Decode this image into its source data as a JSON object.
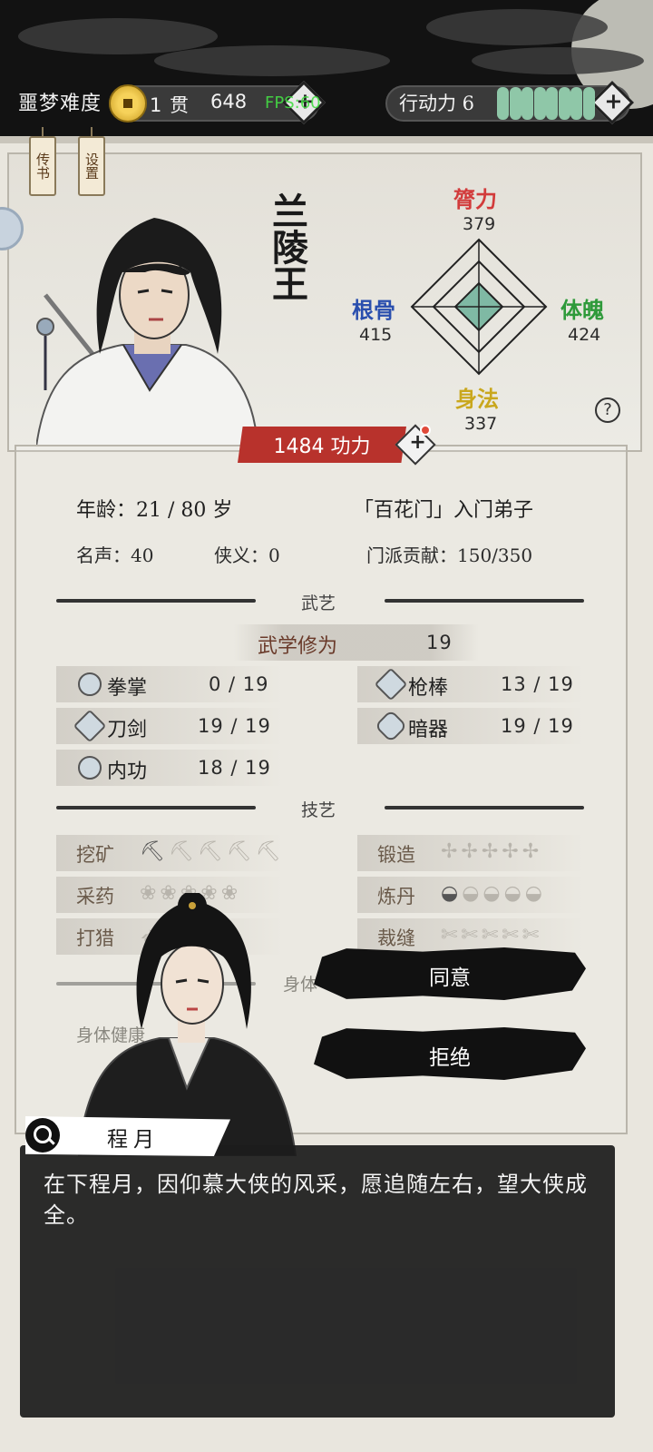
{
  "topbar": {
    "difficulty": "噩梦难度",
    "coins_count": "1 贯",
    "coins_sub": "648",
    "fps_overlay": "FPS:60",
    "action_label": "行动力 6",
    "stamina_filled": 8
  },
  "tassels": {
    "book": "传书",
    "settings": "设置"
  },
  "character": {
    "name": "兰陵王",
    "power": "1484 功力",
    "attributes": {
      "strength": {
        "label": "膂力",
        "value": "379",
        "color": "#d23b3b"
      },
      "constitution": {
        "label": "根骨",
        "value": "415",
        "color": "#2a4fae"
      },
      "physique": {
        "label": "体魄",
        "value": "424",
        "color": "#2e9a3a"
      },
      "agility": {
        "label": "身法",
        "value": "337",
        "color": "#c9a71d"
      }
    }
  },
  "info": {
    "age": "年龄：21 / 80 岁",
    "sect": "「百花门」入门弟子",
    "fame": "名声：40",
    "chivalry": "侠义：0",
    "contribution": "门派贡献：150/350"
  },
  "martial": {
    "section_title": "武艺",
    "cultivation_label": "武学修为",
    "cultivation_value": "19",
    "skills": [
      {
        "label": "拳掌",
        "value": "0 / 19"
      },
      {
        "label": "枪棒",
        "value": "13 / 19"
      },
      {
        "label": "刀剑",
        "value": "19 / 19"
      },
      {
        "label": "暗器",
        "value": "19 / 19"
      },
      {
        "label": "内功",
        "value": "18 / 19"
      }
    ]
  },
  "crafts": {
    "section_title": "技艺",
    "items": [
      {
        "label": "挖矿",
        "level": 1
      },
      {
        "label": "锻造",
        "level": 0
      },
      {
        "label": "采药",
        "level": 0
      },
      {
        "label": "炼丹",
        "level": 1
      },
      {
        "label": "打猎",
        "level": 0
      },
      {
        "label": "裁缝",
        "level": 0
      }
    ]
  },
  "health": {
    "label": "身体健康",
    "partial": "身体"
  },
  "choices": {
    "accept": "同意",
    "reject": "拒绝"
  },
  "dialog": {
    "speaker": "程月",
    "text": "在下程月，因仰慕大侠的风采，愿追随左右，望大侠成全。"
  }
}
